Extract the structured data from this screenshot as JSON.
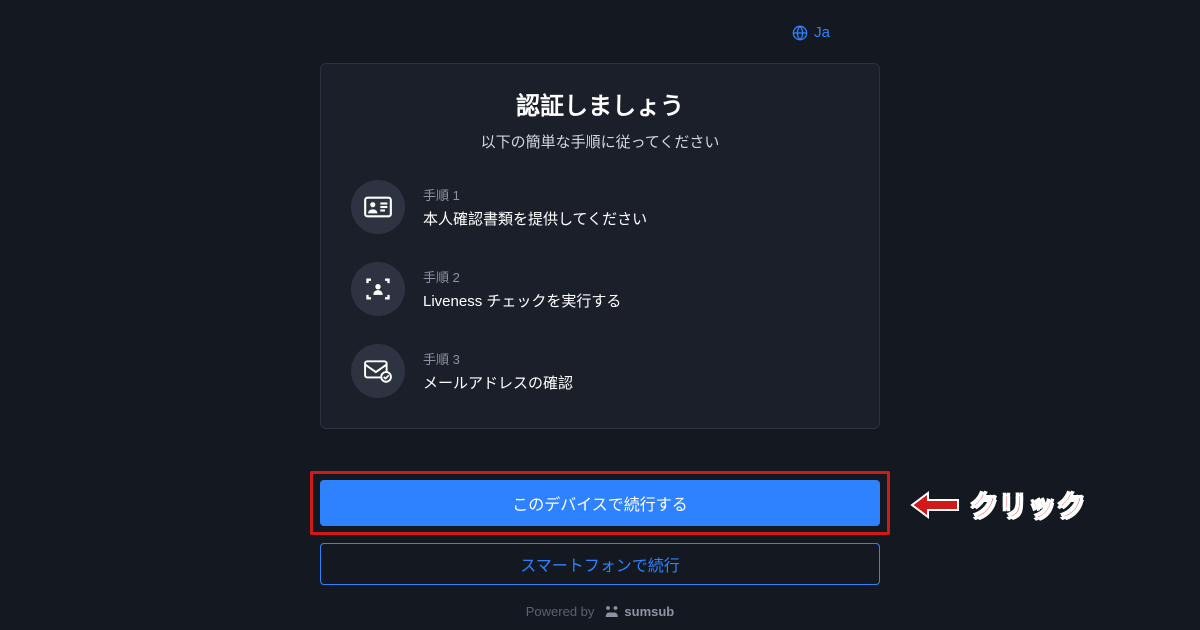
{
  "lang": {
    "label": "Ja"
  },
  "card": {
    "title": "認証しましょう",
    "subtitle": "以下の簡単な手順に従ってください",
    "steps": [
      {
        "label": "手順 1",
        "desc": "本人確認書類を提供してください"
      },
      {
        "label": "手順 2",
        "desc": "Liveness チェックを実行する"
      },
      {
        "label": "手順 3",
        "desc": "メールアドレスの確認"
      }
    ]
  },
  "buttons": {
    "primary": "このデバイスで続行する",
    "secondary": "スマートフォンで続行"
  },
  "annotation": {
    "click_text": "クリック"
  },
  "footer": {
    "powered_by": "Powered by",
    "brand": "sumsub"
  }
}
